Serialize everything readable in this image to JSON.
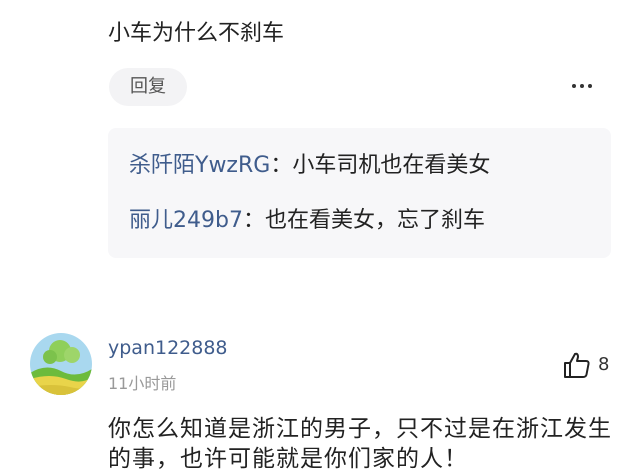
{
  "top_comment": {
    "text": "小车为什么不刹车",
    "reply_label": "回复",
    "more_icon": "more-horizontal-icon",
    "replies": [
      {
        "author": "杀阡陌YwzRG",
        "colon": "：",
        "text": "小车司机也在看美女"
      },
      {
        "author": "丽儿249b7",
        "colon": "：",
        "text": "也在看美女，忘了刹车"
      }
    ]
  },
  "second_comment": {
    "avatar_icon": "avatar-landscape-icon",
    "username": "ypan122888",
    "time": "11小时前",
    "like_icon": "thumbs-up-icon",
    "like_count": "8",
    "text": "你怎么知道是浙江的男子，只不过是在浙江发生的事，也许可能就是你们家的人！"
  },
  "colors": {
    "author_link": "#3f5c8c",
    "reply_box_bg": "#f7f7f9",
    "reply_btn_bg": "#f3f3f5",
    "timestamp": "#999999"
  }
}
